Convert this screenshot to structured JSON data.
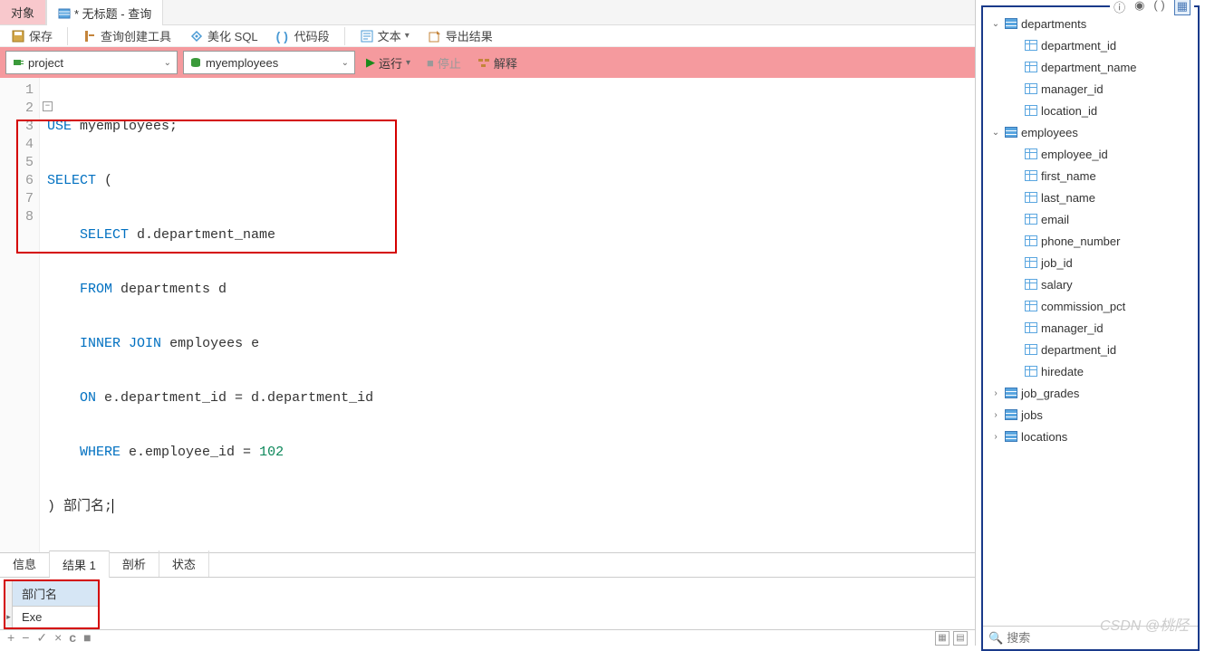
{
  "tabs": {
    "objects": "对象",
    "query": "* 无标题 - 查询"
  },
  "toolbar1": {
    "save": "保存",
    "query_builder": "查询创建工具",
    "beautify": "美化 SQL",
    "snippet": "代码段",
    "text": "文本",
    "export": "导出结果"
  },
  "toolbar2": {
    "connection": "project",
    "database": "myemployees",
    "run": "运行",
    "stop": "停止",
    "explain": "解释"
  },
  "editor": {
    "lines": [
      "1",
      "2",
      "3",
      "4",
      "5",
      "6",
      "7",
      "8"
    ],
    "l1": {
      "kw": "USE",
      "rest": " myemployees;"
    },
    "l2": {
      "kw": "SELECT",
      "rest": " ("
    },
    "l3": {
      "kw": "SELECT",
      "rest": " d.department_name"
    },
    "l4": {
      "kw": "FROM",
      "rest": " departments d"
    },
    "l5": {
      "kw1": "INNER",
      "kw2": "JOIN",
      "rest": " employees e"
    },
    "l6": {
      "kw": "ON",
      "rest": " e.department_id = d.department_id"
    },
    "l7": {
      "kw": "WHERE",
      "mid": " e.employee_id = ",
      "num": "102"
    },
    "l8": {
      "rest": ") 部门名;"
    }
  },
  "result_tabs": {
    "info": "信息",
    "result1": "结果 1",
    "profile": "剖析",
    "status": "状态"
  },
  "result": {
    "header": "部门名",
    "row1": "Exe"
  },
  "bottom_bar": {
    "plus": "+",
    "minus": "−",
    "check": "✓",
    "x": "×",
    "refresh": "c"
  },
  "bottom_right_icons": {
    "grid": "▦",
    "form": "▤"
  },
  "rp_icons": {
    "info": "ⓘ",
    "eye": "👁",
    "paren": "( )",
    "grid": "▦"
  },
  "db_tree": {
    "tables": [
      {
        "name": "departments",
        "expanded": true,
        "columns": [
          "department_id",
          "department_name",
          "manager_id",
          "location_id"
        ]
      },
      {
        "name": "employees",
        "expanded": true,
        "columns": [
          "employee_id",
          "first_name",
          "last_name",
          "email",
          "phone_number",
          "job_id",
          "salary",
          "commission_pct",
          "manager_id",
          "department_id",
          "hiredate"
        ]
      },
      {
        "name": "job_grades",
        "expanded": false,
        "columns": []
      },
      {
        "name": "jobs",
        "expanded": false,
        "columns": []
      },
      {
        "name": "locations",
        "expanded": false,
        "columns": []
      }
    ]
  },
  "search_placeholder": "搜索",
  "watermark": "CSDN @桃陉"
}
